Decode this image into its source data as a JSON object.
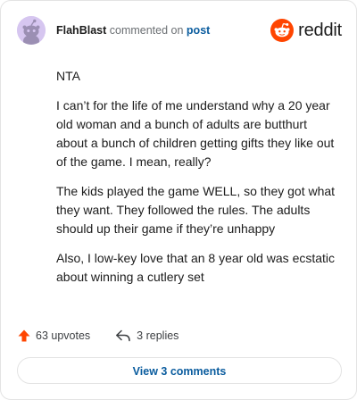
{
  "header": {
    "author": "FlahBlast",
    "verb": "commented on",
    "target": "post",
    "logo_text": "reddit"
  },
  "comment": {
    "paragraphs": [
      "NTA",
      "I can’t for the life of me understand why a 20 year old woman and a bunch of adults are butthurt about a bunch of children getting gifts they like out of the game. I mean, really?",
      "The kids played the game WELL, so they got what they want. They followed the rules. The adults should up their game if they’re unhappy",
      "Also, I low-key love that an 8 year old was ecstatic about winning a cutlery set"
    ]
  },
  "footer": {
    "upvotes_label": "63 upvotes",
    "replies_label": "3 replies"
  },
  "view_comments_label": "View 3 comments",
  "colors": {
    "accent_link": "#0a5c9e",
    "upvote": "#ff4500",
    "avatar_bg": "#d6c6f0"
  },
  "icons": {
    "avatar": "snoo-avatar-icon",
    "logo": "reddit-logo-icon",
    "upvote": "upvote-arrow-icon",
    "reply": "reply-arrow-icon"
  }
}
